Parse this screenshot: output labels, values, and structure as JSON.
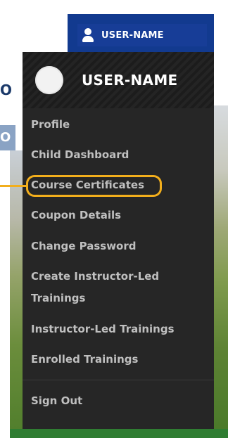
{
  "header": {
    "username": "USER-NAME",
    "user_icon": "user-icon"
  },
  "dropdown": {
    "username": "USER-NAME",
    "avatar_icon": "avatar"
  },
  "menu": {
    "items": [
      {
        "label": "Profile"
      },
      {
        "label": "Child Dashboard"
      },
      {
        "label": "Course Certificates",
        "highlighted": true
      },
      {
        "label": "Coupon Details"
      },
      {
        "label": "Change Password"
      },
      {
        "label": "Create Instructor-Led Trainings"
      },
      {
        "label": "Instructor-Led Trainings"
      },
      {
        "label": "Enrolled Trainings"
      }
    ],
    "sign_out": "Sign Out"
  },
  "colors": {
    "header_blue": "#123a8f",
    "panel_dark": "#262626",
    "menu_text": "#bfbfbf",
    "highlight": "#f2ae1c"
  },
  "background": {
    "left_fragment_1": "OU",
    "left_fragment_2": "O"
  }
}
